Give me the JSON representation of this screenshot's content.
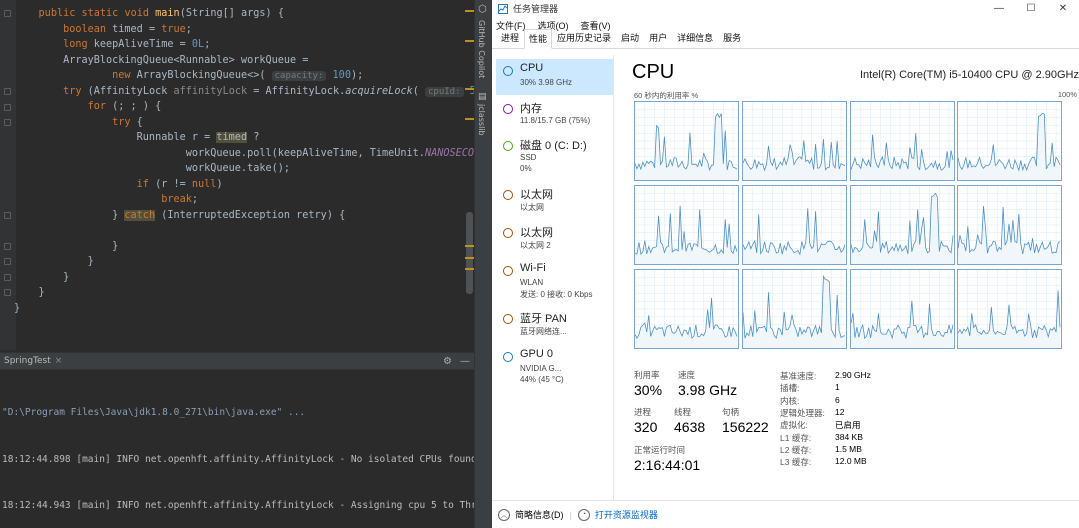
{
  "ide": {
    "code_lines": [
      "    public static void main(String[] args) {",
      "        boolean timed = true;",
      "        long keepAliveTime = 0L;",
      "        ArrayBlockingQueue<Runnable> workQueue =",
      "                new ArrayBlockingQueue<>( capacity: 100);",
      "        try (AffinityLock affinityLock = AffinityLock.acquireLock( cpuId: 5)) {",
      "            for (; ; ) {",
      "                try {",
      "                    Runnable r = timed ?",
      "                            workQueue.poll(keepAliveTime, TimeUnit.NANOSECONDS) :",
      "                            workQueue.take();",
      "                    if (r != null)",
      "                        break;",
      "                } catch (InterruptedException retry) {",
      "",
      "                }",
      "            }",
      "        }",
      "    }",
      "}"
    ],
    "side_tabs": [
      "GitHub Copilot",
      "jclasslib"
    ],
    "run_tab": "SpringTest",
    "run_icons": [
      "gear-icon",
      "minimize-icon"
    ],
    "console_lines": [
      "\"D:\\Program Files\\Java\\jdk1.8.0_271\\bin\\java.exe\" ...",
      "18:12:44.898 [main] INFO net.openhft.affinity.AffinityLock - No isolated CPUs found,",
      "18:12:44.943 [main] INFO net.openhft.affinity.AffinityLock - Assigning cpu 5 to Thre"
    ]
  },
  "taskmgr": {
    "window_title": "任务管理器",
    "menu": [
      "文件(F)",
      "选项(O)",
      "查看(V)"
    ],
    "tabs": [
      "进程",
      "性能",
      "应用历史记录",
      "启动",
      "用户",
      "详细信息",
      "服务"
    ],
    "active_tab": "性能",
    "resources": [
      {
        "title": "CPU",
        "sub": "30% 3.98 GHz",
        "sub2": "",
        "color": "#117dbb"
      },
      {
        "title": "内存",
        "sub": "11.8/15.7 GB (75%)",
        "sub2": "",
        "color": "#8b12ae"
      },
      {
        "title": "磁盘 0 (C: D:)",
        "sub": "SSD",
        "sub2": "0%",
        "color": "#4da60c"
      },
      {
        "title": "以太网",
        "sub": "以太网",
        "sub2": "",
        "color": "#a74f01"
      },
      {
        "title": "以太网",
        "sub": "以太网 2",
        "sub2": "",
        "color": "#a74f01"
      },
      {
        "title": "Wi-Fi",
        "sub": "WLAN",
        "sub2": "发送: 0  接收: 0 Kbps",
        "color": "#a74f01"
      },
      {
        "title": "蓝牙 PAN",
        "sub": "蓝牙网络连...",
        "sub2": "",
        "color": "#a74f01"
      },
      {
        "title": "GPU 0",
        "sub": "NVIDIA G...",
        "sub2": "44% (45 °C)",
        "color": "#117dbb"
      }
    ],
    "cpu": {
      "title": "CPU",
      "model": "Intel(R) Core(TM) i5-10400 CPU @ 2.90GHz",
      "util_label": "60 秒内的利用率 %",
      "max_label": "100%",
      "utilization_label": "利用率",
      "utilization": "30%",
      "speed_label": "速度",
      "speed": "3.98 GHz",
      "processes_label": "进程",
      "processes": "320",
      "threads_label": "线程",
      "threads": "4638",
      "handles_label": "句柄",
      "handles": "156222",
      "uptime_label": "正常运行时间",
      "uptime": "2:16:44:01",
      "details": [
        {
          "label": "基准速度:",
          "value": "2.90 GHz"
        },
        {
          "label": "插槽:",
          "value": "1"
        },
        {
          "label": "内核:",
          "value": "6"
        },
        {
          "label": "逻辑处理器:",
          "value": "12"
        },
        {
          "label": "虚拟化:",
          "value": "已启用"
        },
        {
          "label": "L1 缓存:",
          "value": "384 KB"
        },
        {
          "label": "L2 缓存:",
          "value": "1.5 MB"
        },
        {
          "label": "L3 缓存:",
          "value": "12.0 MB"
        }
      ]
    },
    "footer": {
      "summary": "简略信息(D)",
      "resmon": "打开资源监视器"
    }
  }
}
